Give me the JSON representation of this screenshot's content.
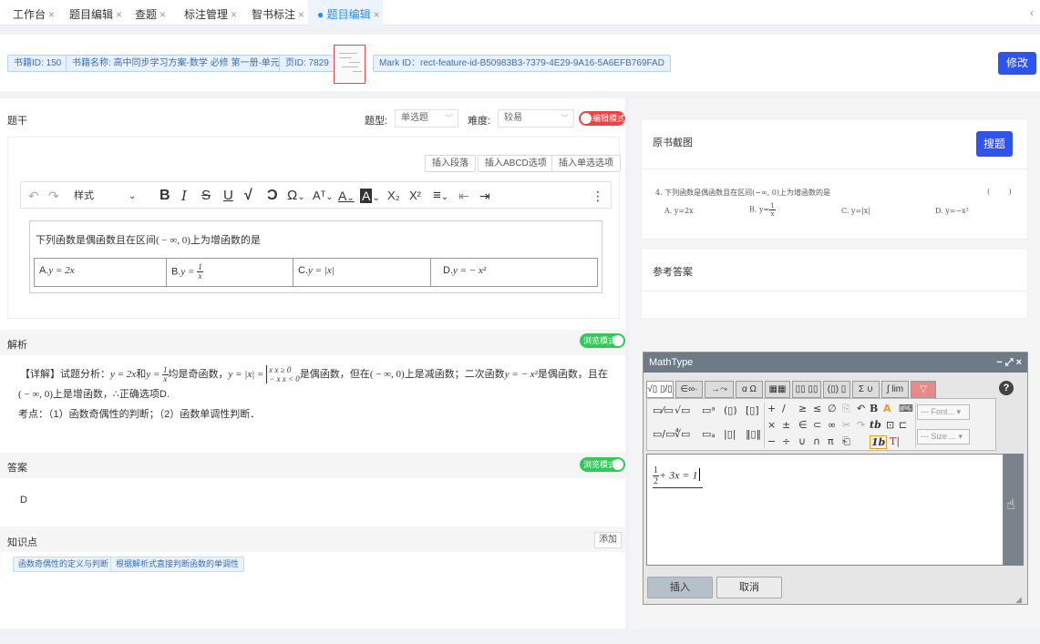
{
  "tabs": [
    {
      "label": "工作台"
    },
    {
      "label": "题目编辑"
    },
    {
      "label": "查题"
    },
    {
      "label": "标注管理"
    },
    {
      "label": "智书标注"
    },
    {
      "label": "● 题目编辑"
    }
  ],
  "tab_close": "×",
  "tab_overflow": "‹",
  "info": {
    "book_id": "书籍ID: 150",
    "book_name": "书籍名称: 高中同步学习方案-数学 必修 第一册-单元检测卷",
    "page_id": "页ID: 7829",
    "mark_id": "Mark ID：rect-feature-id-B50983B3-7379-4E29-9A16-5A6EFB769FAD",
    "edit_button": "修改"
  },
  "stem": {
    "title": "题干",
    "type_label": "题型:",
    "type_value": "单选题",
    "difficulty_label": "难度:",
    "difficulty_value": "较易",
    "mode_toggle": "编辑模式",
    "insert_paragraph": "插入段落",
    "insert_abcd": "插入ABCD选项",
    "insert_single": "插入单选选项",
    "style_label": "样式",
    "question_text": "下列函数是偶函数且在区间",
    "question_interval": "( − ∞, 0)",
    "question_tail": "上为增函数的是",
    "options": [
      {
        "prefix": "A.",
        "expr": "y = 2x"
      },
      {
        "prefix": "B.",
        "expr": "y = 1/x"
      },
      {
        "prefix": "C.",
        "expr": "y = |x|"
      },
      {
        "prefix": "D.",
        "expr": "y = − x²"
      }
    ]
  },
  "analysis": {
    "title": "解析",
    "mode_toggle": "浏览模式",
    "detail_tag": "【详解】",
    "line1_a": "试题分析：",
    "line1_b": "y = 2x",
    "line1_c": "和",
    "line1_d": "y = ",
    "line1_e": "均是奇函数，",
    "line1_f": "y = |x| = ",
    "line1_g": "是偶函数，但在",
    "line1_h": "( − ∞, 0)",
    "line1_i": "上是减函数；二次函数",
    "line1_j": "y = − x²",
    "line1_k": "是偶函数，且在",
    "line2_a": "( − ∞, 0)",
    "line2_b": "上是增函数，∴正确选项D.",
    "line3": "考点：（1）函数奇偶性的判断；（2）函数单调性判断．",
    "piece1": "x   x ≥ 0",
    "piece2": "− x   x < 0"
  },
  "answer": {
    "title": "答案",
    "mode_toggle": "浏览模式",
    "value": "D"
  },
  "knowledge": {
    "title": "知识点",
    "add_button": "添加",
    "items": [
      "函数奇偶性的定义与判断",
      "根据解析式直接判断函数的单调性"
    ]
  },
  "source": {
    "title": "原书截图",
    "search_button": "搜题",
    "question": "4. 下列函数是偶函数且在区间(−∞, 0)上为增函数的是",
    "paren": "(        )",
    "options": [
      "A. y=2x",
      "B. y=",
      "C. y=|x|",
      "D. y=−x²"
    ]
  },
  "reference": {
    "title": "参考答案"
  },
  "mathtype": {
    "title": "MathType",
    "window_controls": "− ⤢ ×",
    "help": "?",
    "tabs": [
      "√▯ ▯/▯",
      "∈∞·",
      "→⤳",
      "α Ω",
      "▦▦",
      "▯▯ ▯▯",
      "(▯) ▯",
      "Σ ∪",
      "∫ lim",
      "▽"
    ],
    "font_placeholder": "--- Font... ▾",
    "size_placeholder": "--- Size ... ▾",
    "equation": "+ 3x = 1",
    "frac_n": "1",
    "frac_d": "2",
    "insert_button": "插入",
    "cancel_button": "取消"
  }
}
